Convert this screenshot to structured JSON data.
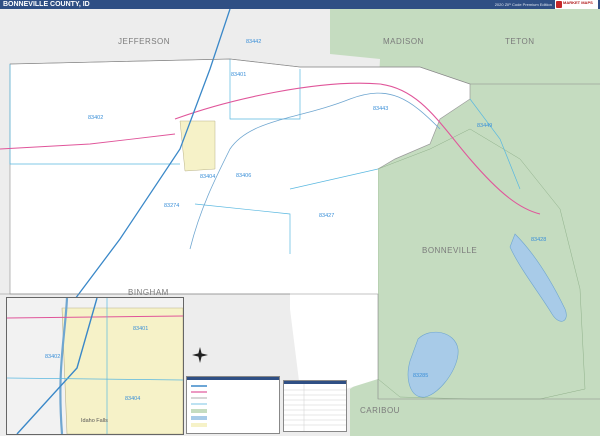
{
  "title": "BONNEVILLE COUNTY, ID",
  "edition": "2020 ZIP Code Premium Edition",
  "logo_text": "MARKET MAPS",
  "county_labels": [
    "JEFFERSON",
    "MADISON",
    "TETON",
    "BONNEVILLE",
    "BINGHAM",
    "CARIBOU"
  ],
  "zip_labels": [
    "83442",
    "83401",
    "83402",
    "83443",
    "83449",
    "83404",
    "83406",
    "83274",
    "83427",
    "83428",
    "83285"
  ],
  "inset": {
    "city_label": "Idaho Falls",
    "zip_labels": [
      "83401",
      "83402",
      "83404"
    ]
  },
  "colors": {
    "national_forest": "#c5dcc0",
    "county_fill": "#ffffff",
    "outside_county": "#ededed",
    "water": "#a8cbe8",
    "city": "#f6f2c8",
    "zip_line": "#5ab8e0",
    "highway": "#e0559a",
    "interstate": "#3a88c8",
    "title_bar": "#2f4f84"
  },
  "icons": [
    "north-arrow-icon",
    "logo-icon"
  ]
}
